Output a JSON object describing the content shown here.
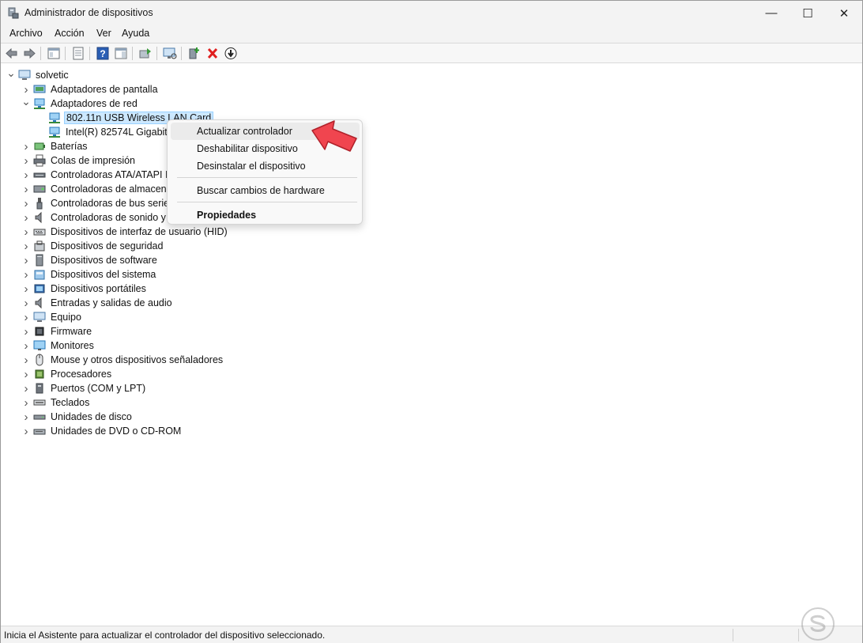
{
  "window": {
    "title": "Administrador de dispositivos",
    "minimize_glyph": "—",
    "maximize_glyph": "☐",
    "close_glyph": "✕"
  },
  "menu": [
    "Archivo",
    "Acción",
    "Ver",
    "Ayuda"
  ],
  "toolbar": {
    "icons": [
      "back-icon",
      "forward-icon",
      "show-hide-console-tree-icon",
      "properties-icon",
      "help-icon",
      "action-pane-icon",
      "update-driver-icon",
      "scan-hardware-icon",
      "add-legacy-hardware-icon",
      "uninstall-device-icon",
      "disable-device-icon"
    ]
  },
  "tree": {
    "root": "solvetic",
    "categories": [
      {
        "label": "Adaptadores de pantalla",
        "icon": "display-adapter-icon"
      },
      {
        "label": "Adaptadores de red",
        "icon": "network-adapter-icon",
        "expanded": true,
        "children": [
          {
            "label": "802.11n USB Wireless LAN Card",
            "icon": "network-adapter-icon",
            "selected": true
          },
          {
            "label": "Intel(R) 82574L Gigabit N",
            "icon": "network-adapter-icon"
          }
        ]
      },
      {
        "label": "Baterías",
        "icon": "battery-icon"
      },
      {
        "label": "Colas de impresión",
        "icon": "printer-icon"
      },
      {
        "label": "Controladoras ATA/ATAPI ID",
        "icon": "ide-controller-icon"
      },
      {
        "label": "Controladoras de almacena",
        "icon": "storage-controller-icon"
      },
      {
        "label": "Controladoras de bus serie",
        "icon": "usb-icon"
      },
      {
        "label": "Controladoras de sonido y v",
        "icon": "speaker-icon"
      },
      {
        "label": "Dispositivos de interfaz de usuario (HID)",
        "icon": "hid-icon"
      },
      {
        "label": "Dispositivos de seguridad",
        "icon": "security-device-icon"
      },
      {
        "label": "Dispositivos de software",
        "icon": "software-device-icon"
      },
      {
        "label": "Dispositivos del sistema",
        "icon": "system-device-icon"
      },
      {
        "label": "Dispositivos portátiles",
        "icon": "portable-device-icon"
      },
      {
        "label": "Entradas y salidas de audio",
        "icon": "speaker-icon"
      },
      {
        "label": "Equipo",
        "icon": "computer-icon"
      },
      {
        "label": "Firmware",
        "icon": "firmware-icon"
      },
      {
        "label": "Monitores",
        "icon": "monitor-icon"
      },
      {
        "label": "Mouse y otros dispositivos señaladores",
        "icon": "mouse-icon"
      },
      {
        "label": "Procesadores",
        "icon": "processor-icon"
      },
      {
        "label": "Puertos (COM y LPT)",
        "icon": "port-icon"
      },
      {
        "label": "Teclados",
        "icon": "keyboard-icon"
      },
      {
        "label": "Unidades de disco",
        "icon": "disk-drive-icon"
      },
      {
        "label": "Unidades de DVD o CD-ROM",
        "icon": "dvd-drive-icon"
      }
    ]
  },
  "context_menu": {
    "items": [
      {
        "label": "Actualizar controlador",
        "highlighted": true
      },
      {
        "label": "Deshabilitar dispositivo"
      },
      {
        "label": "Desinstalar el dispositivo"
      },
      {
        "label": "Buscar cambios de hardware"
      },
      {
        "label": "Propiedades",
        "bold": true
      }
    ]
  },
  "status_bar": {
    "text": "Inicia el Asistente para actualizar el controlador del dispositivo seleccionado."
  },
  "colors": {
    "selection_bg": "#cce8ff",
    "annotation_arrow": "#f0454f"
  }
}
